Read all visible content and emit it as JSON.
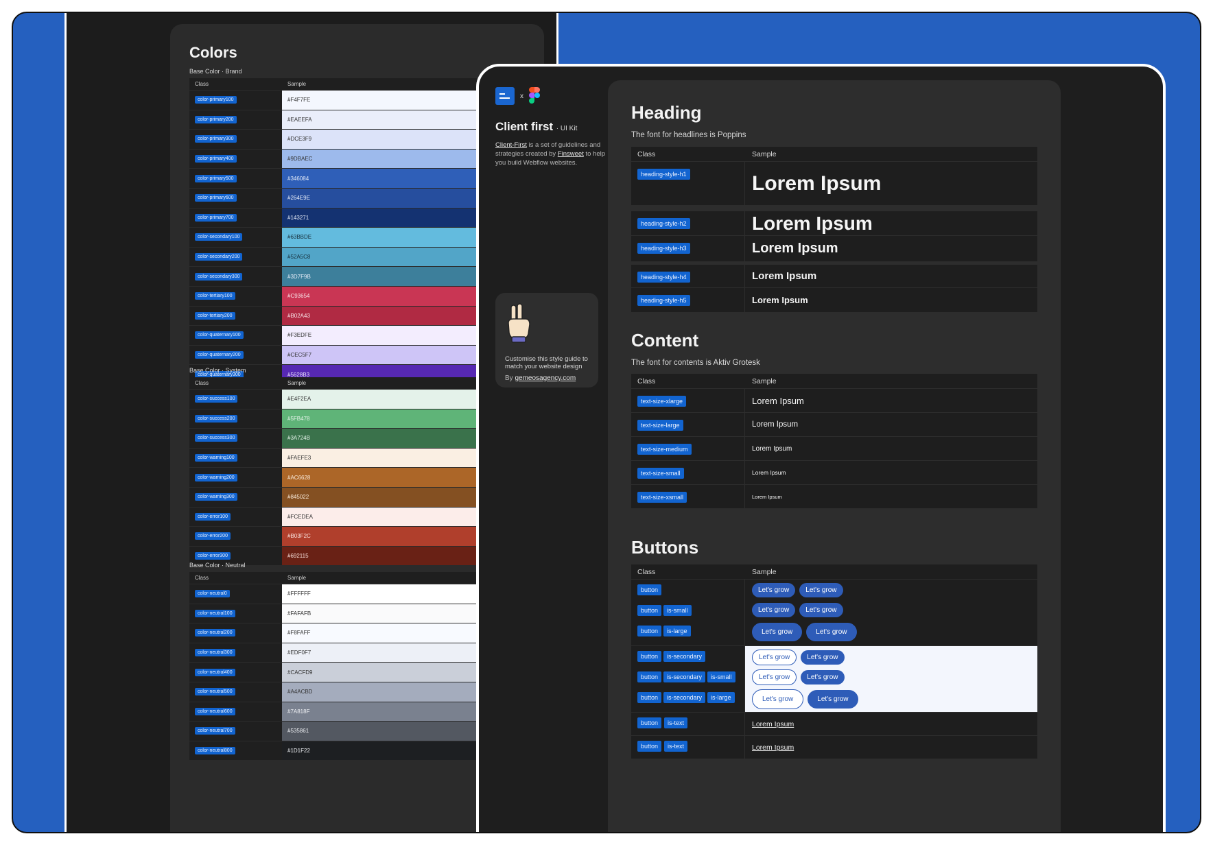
{
  "colors": {
    "title": "Colors",
    "col_class": "Class",
    "col_sample": "Sample",
    "groups": [
      {
        "label": "Base Color · Brand",
        "rows": [
          {
            "cls": "color-primary100",
            "hex": "#F4F7FE",
            "bg": "#F4F7FE",
            "fg": "#333333"
          },
          {
            "cls": "color-primary200",
            "hex": "#EAEEFA",
            "bg": "#EAEEFA",
            "fg": "#333333"
          },
          {
            "cls": "color-primary300",
            "hex": "#DCE3F9",
            "bg": "#DCE3F9",
            "fg": "#333333"
          },
          {
            "cls": "color-primary400",
            "hex": "#9DBAEC",
            "bg": "#9DBAEC",
            "fg": "#333333"
          },
          {
            "cls": "color-primary500",
            "hex": "#346084",
            "bg": "#2F5FB8",
            "fg": "#E8EEF9"
          },
          {
            "cls": "color-primary600",
            "hex": "#264E9E",
            "bg": "#264E9E",
            "fg": "#E8EEF9"
          },
          {
            "cls": "color-primary700",
            "hex": "#143271",
            "bg": "#143271",
            "fg": "#E8EEF9"
          },
          {
            "cls": "color-secondary100",
            "hex": "#63BBDE",
            "bg": "#63BBDE",
            "fg": "#17303d"
          },
          {
            "cls": "color-secondary200",
            "hex": "#52A5C8",
            "bg": "#52A5C8",
            "fg": "#17303d"
          },
          {
            "cls": "color-secondary300",
            "hex": "#3D7F9B",
            "bg": "#3D7F9B",
            "fg": "#E8EEF9"
          },
          {
            "cls": "color-tertiary100",
            "hex": "#C93654",
            "bg": "#C93654",
            "fg": "#F8E6EA"
          },
          {
            "cls": "color-tertiary200",
            "hex": "#B02A43",
            "bg": "#B02A43",
            "fg": "#F8E6EA"
          },
          {
            "cls": "color-quaternary100",
            "hex": "#F3EDFE",
            "bg": "#F3EDFE",
            "fg": "#333333"
          },
          {
            "cls": "color-quaternary200",
            "hex": "#CEC5F7",
            "bg": "#CEC5F7",
            "fg": "#333333"
          },
          {
            "cls": "color-quaternary300",
            "hex": "#5628B3",
            "bg": "#5628B3",
            "fg": "#EDE6FB"
          }
        ]
      },
      {
        "label": "Base Color · System",
        "rows": [
          {
            "cls": "color-success100",
            "hex": "#E4F2EA",
            "bg": "#E4F2EA",
            "fg": "#333333"
          },
          {
            "cls": "color-success200",
            "hex": "#5FB478",
            "bg": "#5FB478",
            "fg": "#E8F5EC"
          },
          {
            "cls": "color-success300",
            "hex": "#3A724B",
            "bg": "#3A724B",
            "fg": "#E8F5EC"
          },
          {
            "cls": "color-warning100",
            "hex": "#FAEFE3",
            "bg": "#FAEFE3",
            "fg": "#333333"
          },
          {
            "cls": "color-warning200",
            "hex": "#AC6628",
            "bg": "#AC6628",
            "fg": "#FBEEDF"
          },
          {
            "cls": "color-warning300",
            "hex": "#845022",
            "bg": "#845022",
            "fg": "#FBEEDF"
          },
          {
            "cls": "color-error100",
            "hex": "#FCEDEA",
            "bg": "#FCEDEA",
            "fg": "#333333"
          },
          {
            "cls": "color-error200",
            "hex": "#B03F2C",
            "bg": "#B03F2C",
            "fg": "#FBE6E1"
          },
          {
            "cls": "color-error300",
            "hex": "#692115",
            "bg": "#692115",
            "fg": "#FBE6E1"
          }
        ]
      },
      {
        "label": "Base Color · Neutral",
        "rows": [
          {
            "cls": "color-neutral0",
            "hex": "#FFFFFF",
            "bg": "#FFFFFF",
            "fg": "#333333"
          },
          {
            "cls": "color-neutral100",
            "hex": "#FAFAFB",
            "bg": "#FAFAFB",
            "fg": "#333333"
          },
          {
            "cls": "color-neutral200",
            "hex": "#F8FAFF",
            "bg": "#F8FAFF",
            "fg": "#333333"
          },
          {
            "cls": "color-neutral300",
            "hex": "#EDF0F7",
            "bg": "#EDF0F7",
            "fg": "#333333"
          },
          {
            "cls": "color-neutral400",
            "hex": "#CACFD9",
            "bg": "#CACFD9",
            "fg": "#333333"
          },
          {
            "cls": "color-neutral500",
            "hex": "#A4ACBD",
            "bg": "#A4ACBD",
            "fg": "#333333"
          },
          {
            "cls": "color-neutral600",
            "hex": "#7A818F",
            "bg": "#7A818F",
            "fg": "#EEF0F4"
          },
          {
            "cls": "color-neutral700",
            "hex": "#535861",
            "bg": "#535861",
            "fg": "#EEF0F4"
          },
          {
            "cls": "color-neutral800",
            "hex": "#1D1F22",
            "bg": "#1D1F22",
            "fg": "#EEF0F4"
          }
        ]
      }
    ]
  },
  "sidebar": {
    "logo_x": "x",
    "title": "Client first",
    "title_suffix": "· UI Kit",
    "desc_link1": "Client-First",
    "desc_mid": " is a set of guidelines and strategies created by ",
    "desc_link2": "Finsweet",
    "desc_end": " to help you build Webflow websites.",
    "card_text": "Customise this style guide to match your website design",
    "card_by": "By ",
    "card_link": "gemeosagency.com"
  },
  "heading": {
    "title": "Heading",
    "subtitle": "The font for headlines is Poppins",
    "col_class": "Class",
    "col_sample": "Sample",
    "rows": [
      {
        "cls": "heading-style-h1",
        "sample": "Lorem Ipsum"
      },
      {
        "cls": "heading-style-h2",
        "sample": "Lorem Ipsum"
      },
      {
        "cls": "heading-style-h3",
        "sample": "Lorem Ipsum"
      },
      {
        "cls": "heading-style-h4",
        "sample": "Lorem Ipsum"
      },
      {
        "cls": "heading-style-h5",
        "sample": "Lorem Ipsum"
      }
    ]
  },
  "content": {
    "title": "Content",
    "subtitle": "The font for contents is Aktiv Grotesk",
    "col_class": "Class",
    "col_sample": "Sample",
    "rows": [
      {
        "cls": "text-size-xlarge",
        "sample": "Lorem Ipsum"
      },
      {
        "cls": "text-size-large",
        "sample": "Lorem Ipsum"
      },
      {
        "cls": "text-size-medium",
        "sample": "Lorem Ipsum"
      },
      {
        "cls": "text-size-small",
        "sample": "Lorem Ipsum"
      },
      {
        "cls": "text-size-xsmall",
        "sample": "Lorem Ipsum"
      }
    ]
  },
  "buttons": {
    "title": "Buttons",
    "col_class": "Class",
    "col_sample": "Sample",
    "btn_label": "Let's grow",
    "tag_button": "button",
    "tag_small": "is-small",
    "tag_large": "is-large",
    "tag_secondary": "is-secondary",
    "tag_text": "is-text",
    "link_label": "Lorem Ipsum"
  }
}
